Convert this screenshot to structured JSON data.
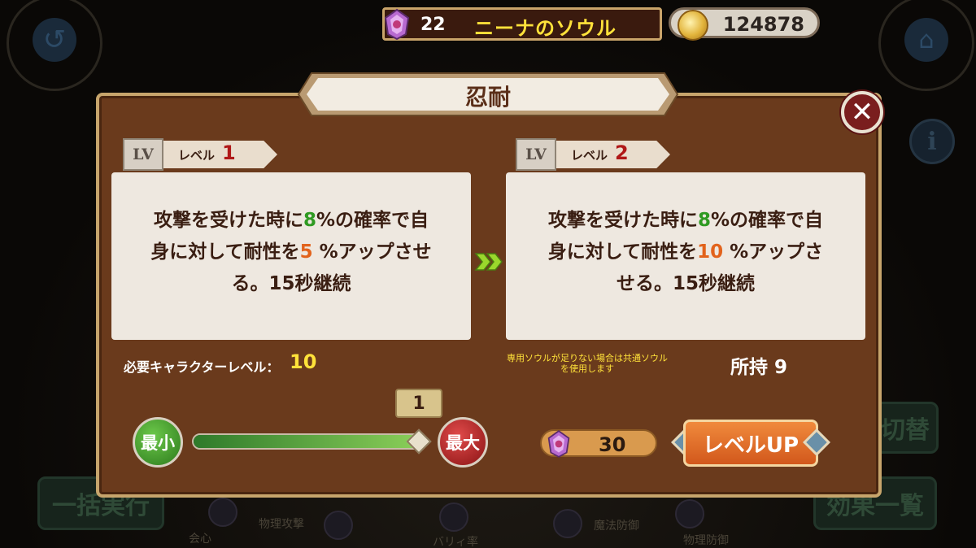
{
  "top_bar": {
    "soul_count": "22",
    "soul_name": "ニーナのソウル",
    "coins": "124878"
  },
  "background": {
    "button_left_top": "一括実行",
    "button_right_top": "切替",
    "button_right_bottom": "効果一覧",
    "labels": [
      "会心",
      "物理攻撃",
      "バリィ率",
      "魔法防御",
      "物理防御"
    ]
  },
  "dialog": {
    "title": "忍耐",
    "current": {
      "lv_badge": "LV",
      "level_label": "レベル",
      "level_value": "1",
      "desc": {
        "p1": "攻撃を受けた時に",
        "chance": "8",
        "p2": "%の確率で自",
        "p3": "身に対して耐性を",
        "amount": "5",
        "p4": " %アップさせ",
        "p5": "る。15秒継続"
      }
    },
    "next": {
      "lv_badge": "LV",
      "level_label": "レベル",
      "level_value": "2",
      "desc": {
        "p1": "攻撃を受けた時に",
        "chance": "8",
        "p2": "%の確率で自",
        "p3": "身に対して耐性を",
        "amount": "10",
        "p4": " %アップさ",
        "p5": "せる。15秒継続"
      }
    },
    "requirement_label": "必要キャラクターレベル：",
    "requirement_value": "10",
    "note_line1": "専用ソウルが足りない場合は共通ソウル",
    "note_line2": "を使用します",
    "owned_label": "所持",
    "owned_value": "9",
    "slider": {
      "min_label": "最小",
      "max_label": "最大",
      "value": "1",
      "fill_fraction": 1.0
    },
    "cost": "30",
    "levelup_label": "レベルUP"
  },
  "colors": {
    "accent_green": "#2f9a22",
    "accent_orange": "#e2631c",
    "level_red": "#b01818",
    "highlight_yellow": "#ffe23a"
  }
}
